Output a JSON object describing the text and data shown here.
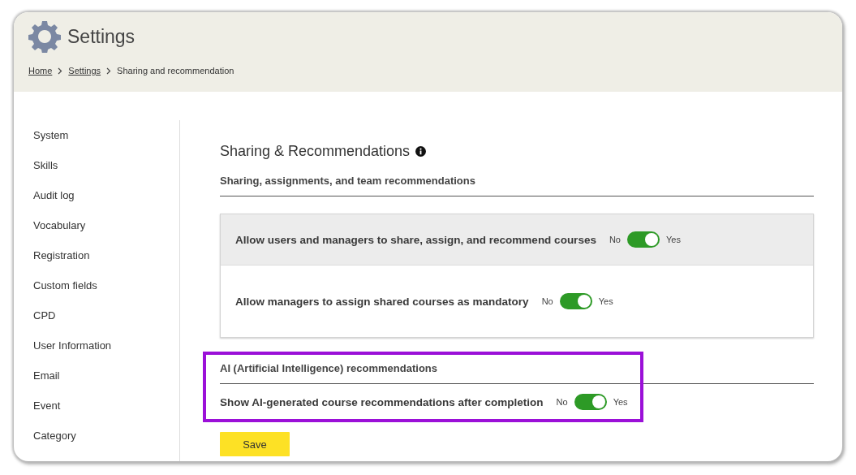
{
  "header": {
    "title": "Settings",
    "breadcrumb": [
      {
        "label": "Home",
        "link": true
      },
      {
        "label": "Settings",
        "link": true
      },
      {
        "label": "Sharing and recommendation",
        "link": false
      }
    ]
  },
  "sidebar": {
    "items": [
      {
        "label": "System"
      },
      {
        "label": "Skills"
      },
      {
        "label": "Audit log"
      },
      {
        "label": "Vocabulary"
      },
      {
        "label": "Registration"
      },
      {
        "label": "Custom fields"
      },
      {
        "label": "CPD"
      },
      {
        "label": "User Information"
      },
      {
        "label": "Email"
      },
      {
        "label": "Event"
      },
      {
        "label": "Category"
      }
    ]
  },
  "main": {
    "title": "Sharing & Recommendations",
    "sharing": {
      "heading": "Sharing, assignments, and team recommendations",
      "rows": [
        {
          "label": "Allow users and managers to share, assign, and recommend courses",
          "off_label": "No",
          "on_label": "Yes",
          "on": true,
          "highlighted": true
        },
        {
          "label": "Allow managers to assign shared courses as mandatory",
          "off_label": "No",
          "on_label": "Yes",
          "on": true,
          "highlighted": false
        }
      ]
    },
    "ai": {
      "heading": "AI (Artificial Intelligence) recommendations",
      "outlined": true,
      "rows": [
        {
          "label": "Show AI-generated course recommendations after completion",
          "off_label": "No",
          "on_label": "Yes",
          "on": true
        }
      ]
    },
    "save_button": "Save"
  }
}
